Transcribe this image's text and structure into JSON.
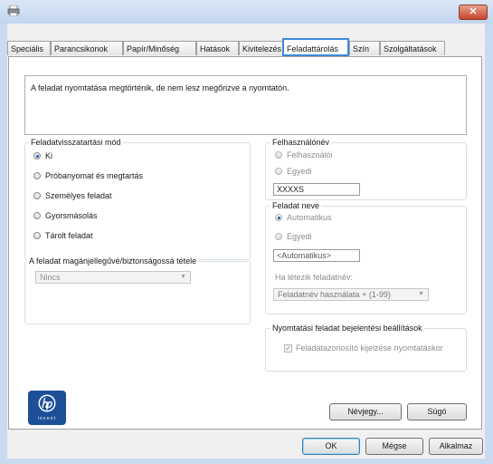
{
  "tabs": [
    {
      "label": "Speciális"
    },
    {
      "label": "Parancsikonok"
    },
    {
      "label": "Papír/Minőség"
    },
    {
      "label": "Hatások"
    },
    {
      "label": "Kivitelezés"
    },
    {
      "label": "Feladattárolás"
    },
    {
      "label": "Szín"
    },
    {
      "label": "Szolgáltatások"
    }
  ],
  "active_tab": "Feladattárolás",
  "message": "A feladat nyomtatása megtörténik, de nem lesz megőrizve a nyomtatón.",
  "job_mode": {
    "title": "Feladatvisszatartási mód",
    "options": [
      "Ki",
      "Próbanyomat és megtartás",
      "Személyes feladat",
      "Gyorsmásolás",
      "Tárolt feladat"
    ],
    "selected": "Ki"
  },
  "privacy": {
    "title": "A feladat magánjellegűvé/biztonságossá tétele",
    "value": "Nincs"
  },
  "username": {
    "title": "Felhasználónév",
    "options": [
      "Felhasználói",
      "Egyedi"
    ],
    "value": "XXXXS"
  },
  "job_name": {
    "title": "Feladat neve",
    "options": [
      "Automatikus",
      "Egyedi"
    ],
    "value": "<Automatikus>",
    "if_exists_label": "Ha létezik feladatnév:",
    "if_exists_value": "Feladatnév használata + (1-99)"
  },
  "notify": {
    "title": "Nyomtatási feladat bejelentési beállítások",
    "checkbox": "Feladatazonosító kijelzése nyomtatáskor",
    "checked": true
  },
  "logo_text": "invent",
  "buttons": {
    "about": "Névjegy...",
    "help": "Súgó",
    "ok": "OK",
    "cancel": "Mégse",
    "apply": "Alkalmaz"
  },
  "colors": {
    "active_tab_border": "#3c8ad8",
    "close_button": "#c8452c",
    "hp_logo": "#1d4f99"
  }
}
